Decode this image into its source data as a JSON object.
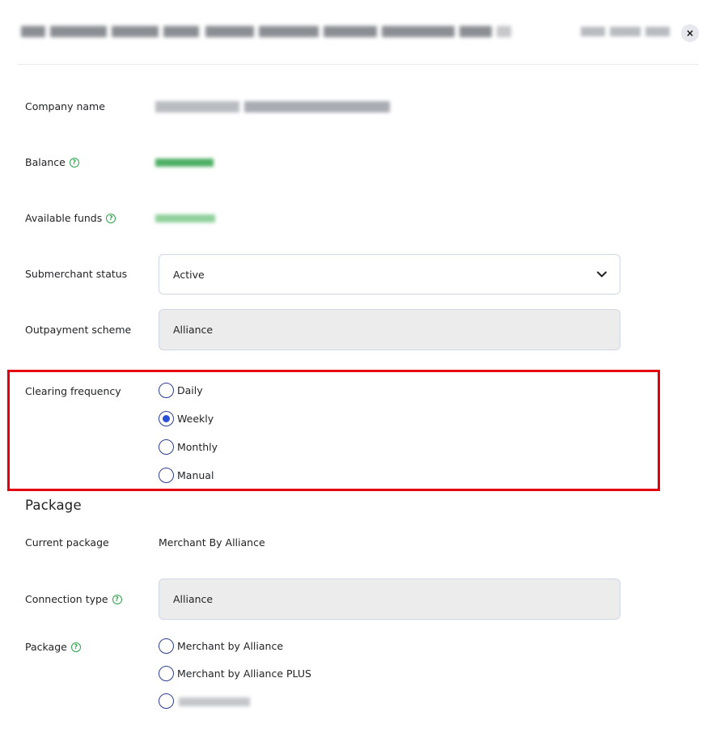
{
  "header": {
    "close_symbol": "×"
  },
  "details": {
    "company_name_label": "Company name",
    "balance_label": "Balance",
    "available_funds_label": "Available funds",
    "help_icon_glyph": "?",
    "submerchant_status_label": "Submerchant status",
    "submerchant_status_value": "Active",
    "outpayment_scheme_label": "Outpayment scheme",
    "outpayment_scheme_value": "Alliance"
  },
  "clearing": {
    "label": "Clearing frequency",
    "options": [
      {
        "label": "Daily",
        "checked": false
      },
      {
        "label": "Weekly",
        "checked": true
      },
      {
        "label": "Monthly",
        "checked": false
      },
      {
        "label": "Manual",
        "checked": false
      }
    ],
    "highlight_color": "#e3000f"
  },
  "package_section": {
    "title": "Package",
    "current_package_label": "Current package",
    "current_package_value": "Merchant By Alliance",
    "connection_type_label": "Connection type",
    "connection_type_value": "Alliance",
    "package_label": "Package",
    "options": [
      {
        "label": "Merchant by Alliance",
        "checked": false
      },
      {
        "label": "Merchant by Alliance PLUS",
        "checked": false
      }
    ]
  },
  "colors": {
    "help_green": "#2fa34d",
    "radio_border": "#2d3f8f",
    "radio_fill": "#2a50d8",
    "field_border": "#cfd6e4",
    "readonly_bg": "#ececec"
  },
  "icons": {
    "close": "close-icon",
    "help": "help-circle-icon",
    "dropdown": "chevron-down-icon"
  }
}
